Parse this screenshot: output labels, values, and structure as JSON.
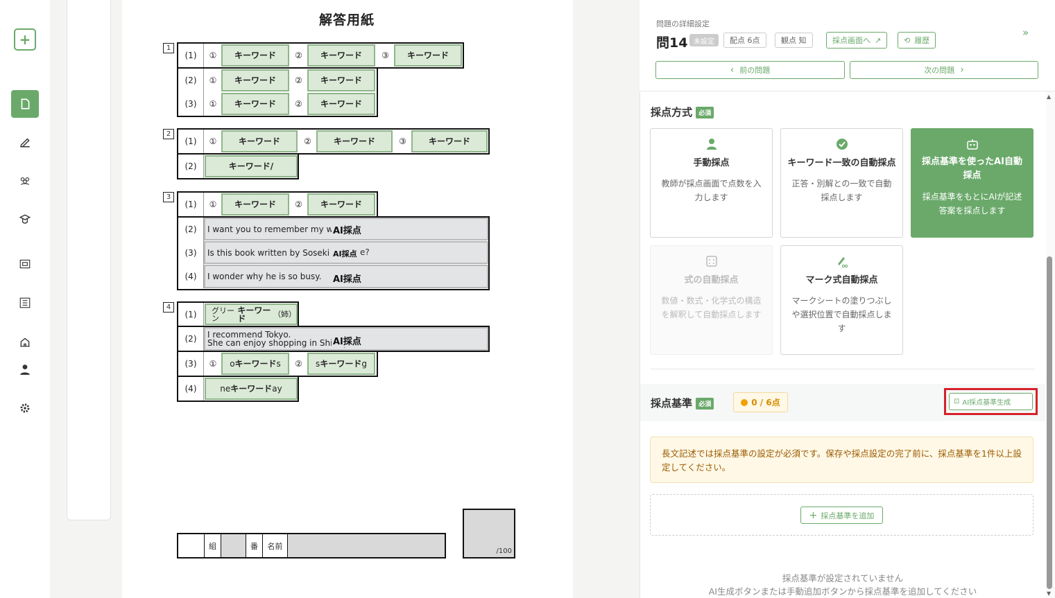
{
  "sheet": {
    "title": "解答用紙",
    "keyword": "キーワード",
    "keyword_cut": "キーワード/",
    "ai_label": "AI採点",
    "q1": {
      "num": "1",
      "rows": [
        "(1)",
        "(2)",
        "(3)"
      ]
    },
    "q2": {
      "num": "2",
      "rows": [
        "(1)",
        "(2)"
      ]
    },
    "q3": {
      "num": "3",
      "rows": [
        "(1)",
        "(2)",
        "(3)",
        "(4)"
      ],
      "r2_text": "I want you to remember my w",
      "r3_text_a": "Is this book written by Soseki N",
      "r3_text_b": "e?",
      "r4_text": "I wonder why he is so busy."
    },
    "q4": {
      "num": "4",
      "rows": [
        "(1)",
        "(2)",
        "(3)",
        "(4)"
      ],
      "r1_pre": "グリーン",
      "r1_post": "（姉）",
      "r2_line1": "I recommend Tokyo.",
      "r2_line2": "She can enjoy shopping in Shibuya.",
      "r3_pre": "o",
      "r3_post": "s",
      "r3b_pre": "s",
      "r3b_post": "g",
      "r4_pre": "ne",
      "r4_post": "ay"
    },
    "circle1": "①",
    "circle2": "②",
    "circle3": "③",
    "footer": {
      "kumi": "組",
      "ban": "番",
      "name": "名前",
      "score": "/100"
    }
  },
  "panel": {
    "header_small": "問題の詳細設定",
    "question_title": "問14",
    "unset_badge": "未設定",
    "points": "配点 6点",
    "view": "観点 知",
    "to_grading": "採点画面へ",
    "history": "履歴",
    "prev": "前の問題",
    "next": "次の問題",
    "collapse_icon": "»"
  },
  "method": {
    "title": "採点方式",
    "required": "必須",
    "cards": [
      {
        "title": "手動採点",
        "desc": "教師が採点画面で点数を入力します",
        "icon": "person-icon"
      },
      {
        "title": "キーワード一致の自動採点",
        "desc": "正答・別解との一致で自動採点します",
        "icon": "check-circle-icon"
      },
      {
        "title": "採点基準を使ったAI自動採点",
        "desc": "採点基準をもとにAIが記述答案を採点します",
        "icon": "robot-icon"
      },
      {
        "title": "式の自動採点",
        "desc": "数値・数式・化学式の構造を解釈して自動採点します",
        "icon": "calculator-icon"
      },
      {
        "title": "マーク式自動採点",
        "desc": "マークシートの塗りつぶしや選択位置で自動採点します",
        "icon": "mark-icon"
      }
    ]
  },
  "criteria": {
    "title": "採点基準",
    "required": "必須",
    "score": "0 / 6点",
    "ai_gen": "AI採点基準生成",
    "warning": "長文記述では採点基準の設定が必須です。保存や採点設定の完了前に、採点基準を1件以上設定してください。",
    "add": "採点基準を追加",
    "empty1": "採点基準が設定されていません",
    "empty2": "AI生成ボタンまたは手動追加ボタンから採点基準を追加してください"
  },
  "colors": {
    "accent": "#6aa96a",
    "highlight": "#d6202a",
    "warning_bg": "#fff8e6"
  }
}
